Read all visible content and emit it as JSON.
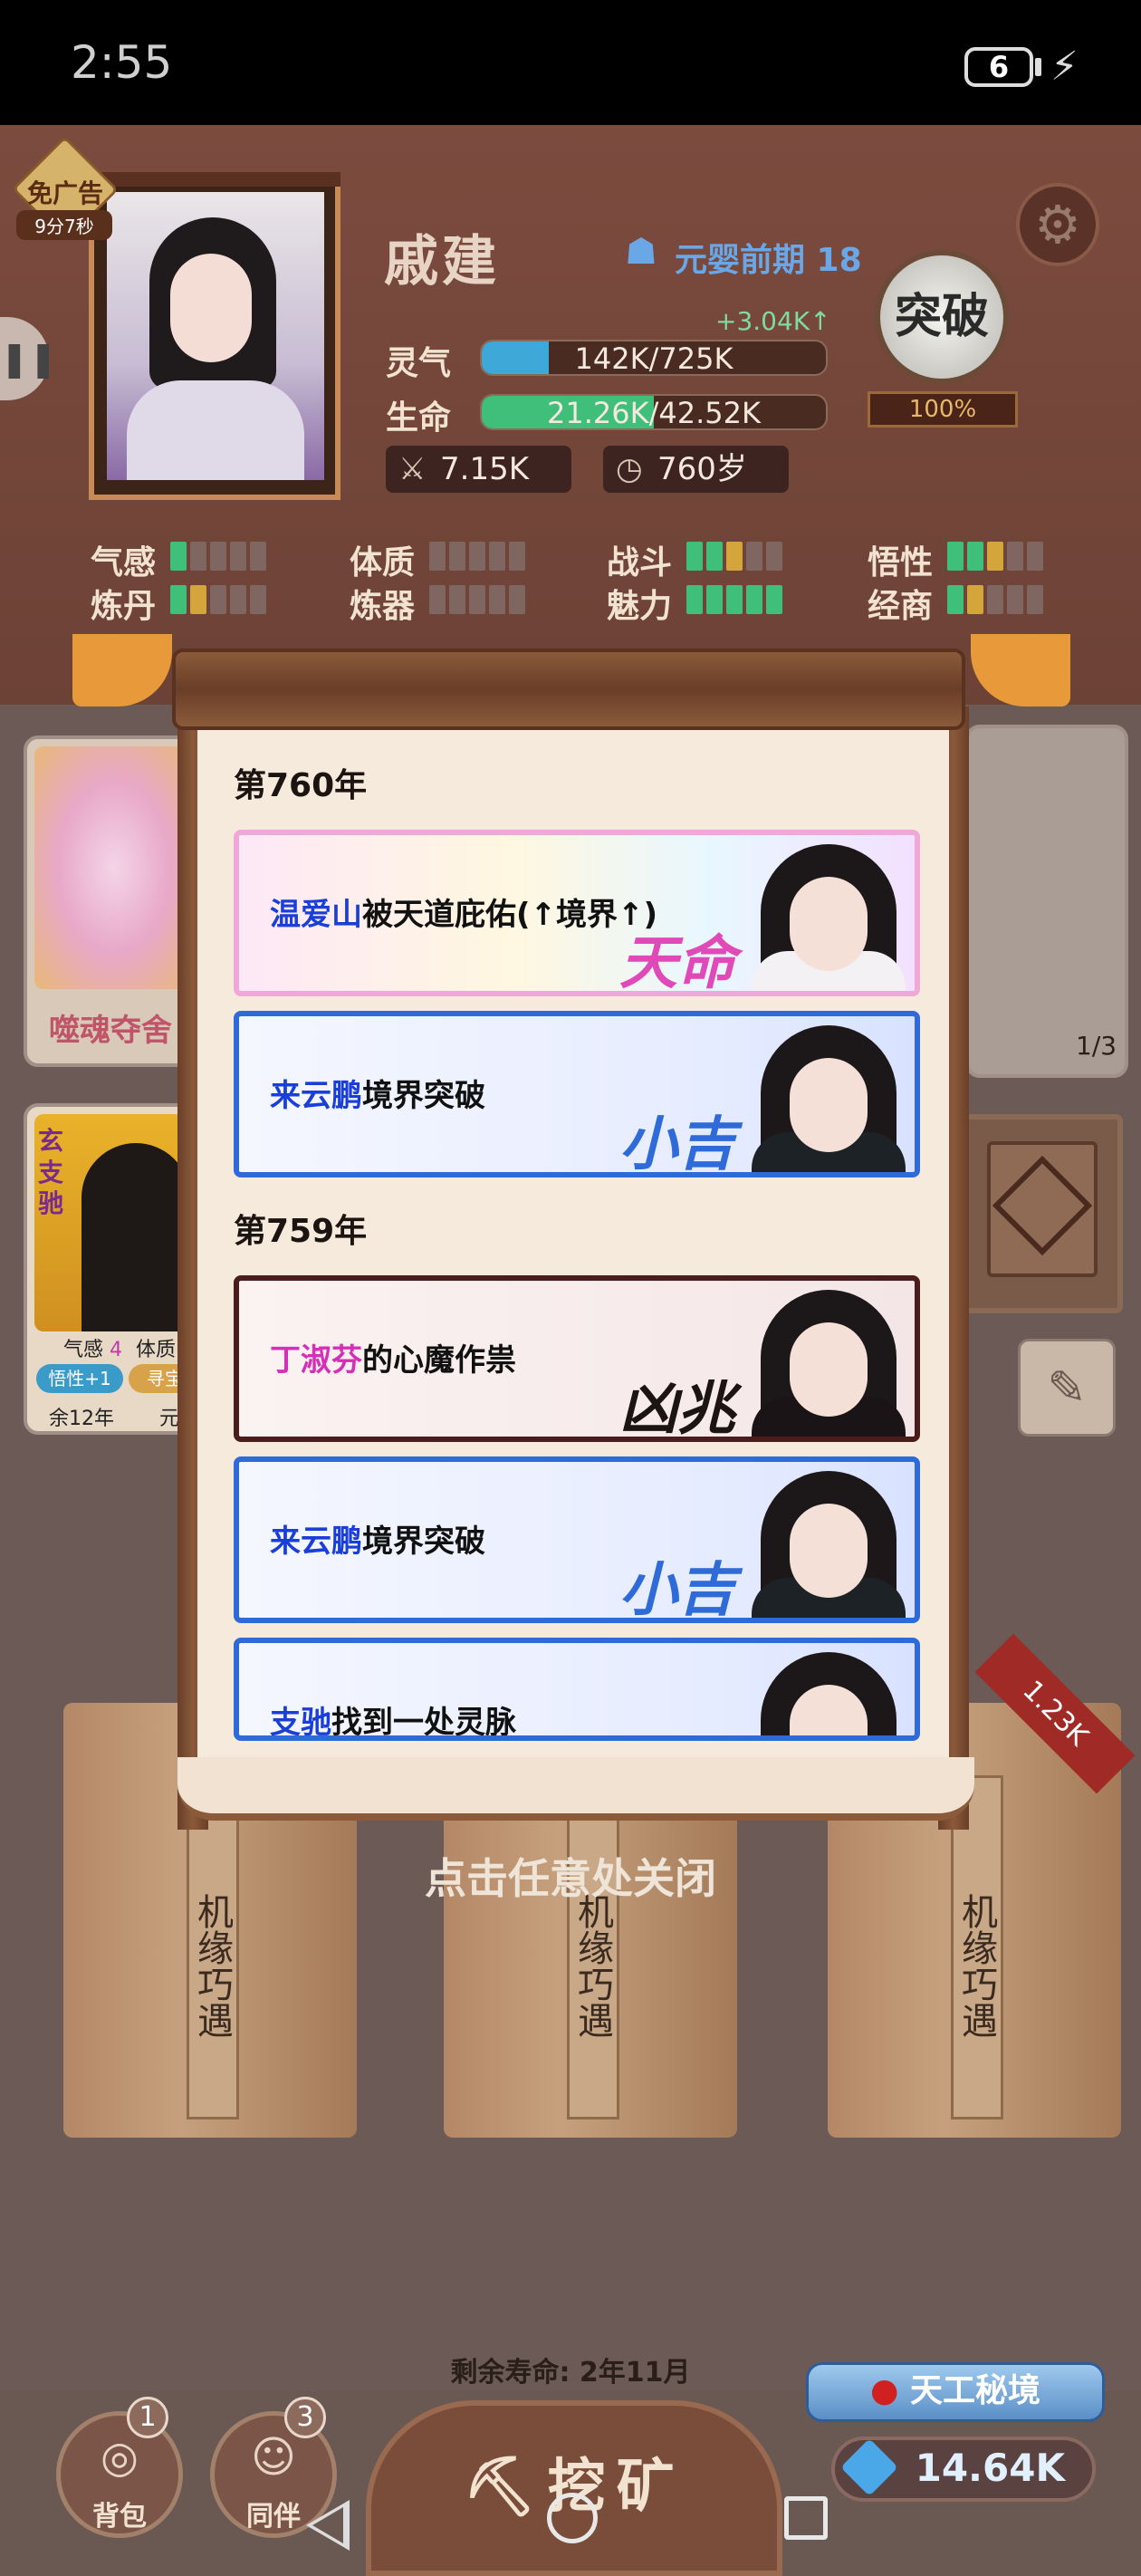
{
  "status_bar": {
    "time": "2:55",
    "battery": "6"
  },
  "ad_badge": {
    "label": "免广告",
    "timer": "9分7秒"
  },
  "player": {
    "name": "戚建",
    "realm": "元婴前期 18",
    "qi_gain": "+3.04K↑",
    "qi_label": "灵气",
    "qi_value": "142K/725K",
    "qi_fraction": 0.196,
    "life_label": "生命",
    "life_value": "21.26K/42.52K",
    "life_fraction": 0.5,
    "attack": "7.15K",
    "age": "760岁"
  },
  "breakthrough": {
    "label": "突破",
    "percent": "100%"
  },
  "attributes": [
    {
      "label": "气感",
      "pips": [
        "g",
        "",
        "",
        "",
        ""
      ]
    },
    {
      "label": "体质",
      "pips": [
        "",
        "",
        "",
        "",
        ""
      ]
    },
    {
      "label": "战斗",
      "pips": [
        "g",
        "g",
        "y",
        "",
        ""
      ]
    },
    {
      "label": "悟性",
      "pips": [
        "g",
        "g",
        "y",
        "",
        ""
      ]
    },
    {
      "label": "炼丹",
      "pips": [
        "g",
        "y",
        "",
        "",
        ""
      ]
    },
    {
      "label": "炼器",
      "pips": [
        "",
        "",
        "",
        "",
        ""
      ]
    },
    {
      "label": "魅力",
      "pips": [
        "g",
        "g",
        "g",
        "g",
        "g"
      ]
    },
    {
      "label": "经商",
      "pips": [
        "g",
        "y",
        "",
        "",
        ""
      ]
    }
  ],
  "cards": {
    "skill_name": "噬魂夺舍",
    "companion": {
      "tag1": "玄",
      "tag2": "支驰",
      "stat1": "气感",
      "stat1_val": "4",
      "stat2": "体质",
      "chip1": "悟性+1",
      "chip2": "寻宝",
      "life": "余12年",
      "other": "元"
    }
  },
  "page_indicator": "1/3",
  "dialog": {
    "groups": [
      {
        "year": "第760年",
        "events": [
          {
            "name": "温爱山",
            "text": "被天道庇佑(↑境界↑)",
            "tag": "天命",
            "style": "rainbow",
            "name_color": "blue"
          },
          {
            "name": "来云鹏",
            "text": "境界突破",
            "tag": "小吉",
            "style": "blue",
            "name_color": "blue"
          }
        ]
      },
      {
        "year": "第759年",
        "events": [
          {
            "name": "丁淑芬",
            "text": "的心魔作祟",
            "tag": "凶兆",
            "style": "dark",
            "name_color": "pink"
          },
          {
            "name": "来云鹏",
            "text": "境界突破",
            "tag": "小吉",
            "style": "blue",
            "name_color": "blue"
          },
          {
            "name": "支驰",
            "text": "找到一处灵脉",
            "tag": "",
            "style": "blue",
            "name_color": "blue"
          }
        ]
      }
    ],
    "close_hint": "点击任意处关闭"
  },
  "pillars": {
    "label": "机缘巧遇"
  },
  "diamond_tag": "1.23K",
  "lifespan": "剩余寿命: 2年11月",
  "bottom": {
    "bag_label": "背包",
    "bag_badge": "1",
    "companion_label": "同伴",
    "companion_badge": "3",
    "mine_label": "挖矿",
    "secret_realm": "天工秘境",
    "gems": "14.64K"
  },
  "colors": {
    "green_bar": "#3fbf79",
    "blue_bar": "#3ea8d8",
    "accent_blue": "#6aa7e6"
  }
}
